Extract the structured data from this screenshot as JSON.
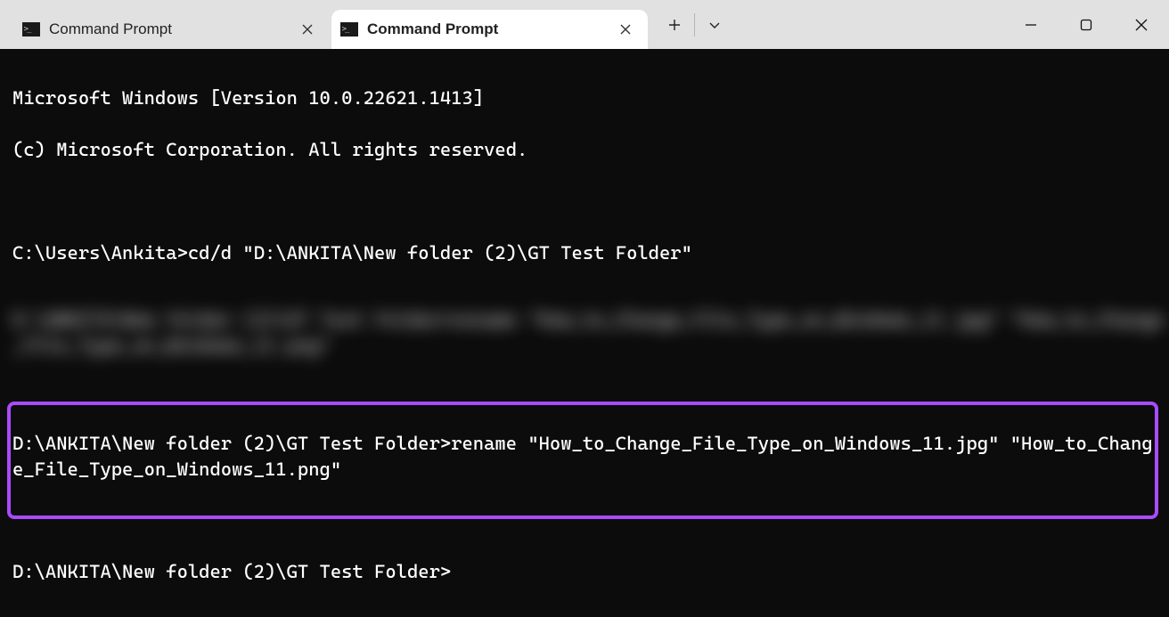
{
  "tabs": [
    {
      "label": "Command Prompt"
    },
    {
      "label": "Command Prompt"
    }
  ],
  "terminal": {
    "ver_line": "Microsoft Windows [Version 10.0.22621.1413]",
    "copyright": "(c) Microsoft Corporation. All rights reserved.",
    "prompt1": "C:\\Users\\Ankita>",
    "cmd1": "cd/d \"D:\\ANKITA\\New folder (2)\\GT Test Folder\"",
    "blurred": "D:\\ANKITA\\New folder (2)\\GT Test Folder>rename \"How_to_Change_File_Type_on_Windows_11.jpg\" \"How_to_Change_File_Type_on_Windows_11.png\"",
    "highlight_prompt": "D:\\ANKITA\\New folder (2)\\GT Test Folder>",
    "highlight_cmd": "rename \"How_to_Change_File_Type_on_Windows_11.jpg\" \"How_to_Change_File_Type_on_Windows_11.png\"",
    "prompt2": "D:\\ANKITA\\New folder (2)\\GT Test Folder>"
  }
}
